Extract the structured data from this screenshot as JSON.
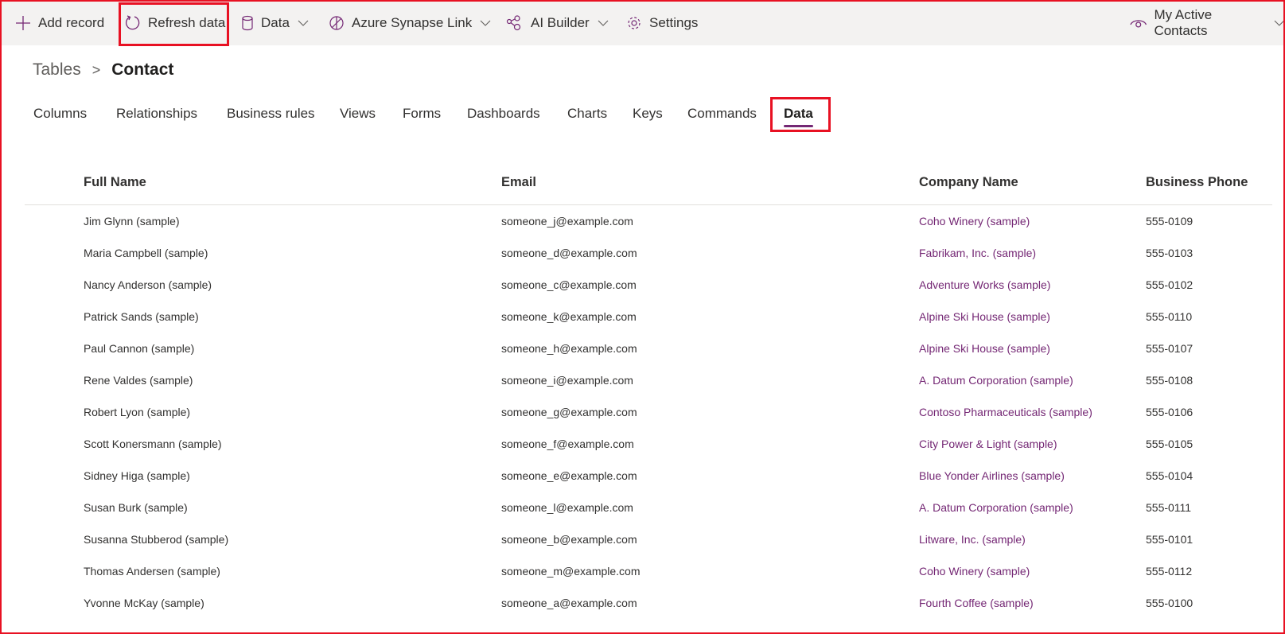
{
  "toolbar": {
    "add_record": "Add record",
    "refresh_data": "Refresh data",
    "data": "Data",
    "azure_synapse_link": "Azure Synapse Link",
    "ai_builder": "AI Builder",
    "settings": "Settings",
    "view_selector": "My Active Contacts"
  },
  "breadcrumb": {
    "parent": "Tables",
    "separator": ">",
    "current": "Contact"
  },
  "tabs": [
    {
      "label": "Columns"
    },
    {
      "label": "Relationships"
    },
    {
      "label": "Business rules"
    },
    {
      "label": "Views"
    },
    {
      "label": "Forms"
    },
    {
      "label": "Dashboards"
    },
    {
      "label": "Charts"
    },
    {
      "label": "Keys"
    },
    {
      "label": "Commands"
    },
    {
      "label": "Data",
      "active": true
    }
  ],
  "table": {
    "columns": [
      "Full Name",
      "Email",
      "Company Name",
      "Business Phone"
    ],
    "rows": [
      [
        "Jim Glynn (sample)",
        "someone_j@example.com",
        "Coho Winery (sample)",
        "555-0109"
      ],
      [
        "Maria Campbell (sample)",
        "someone_d@example.com",
        "Fabrikam, Inc. (sample)",
        "555-0103"
      ],
      [
        "Nancy Anderson (sample)",
        "someone_c@example.com",
        "Adventure Works (sample)",
        "555-0102"
      ],
      [
        "Patrick Sands (sample)",
        "someone_k@example.com",
        "Alpine Ski House (sample)",
        "555-0110"
      ],
      [
        "Paul Cannon (sample)",
        "someone_h@example.com",
        "Alpine Ski House (sample)",
        "555-0107"
      ],
      [
        "Rene Valdes (sample)",
        "someone_i@example.com",
        "A. Datum Corporation (sample)",
        "555-0108"
      ],
      [
        "Robert Lyon (sample)",
        "someone_g@example.com",
        "Contoso Pharmaceuticals (sample)",
        "555-0106"
      ],
      [
        "Scott Konersmann (sample)",
        "someone_f@example.com",
        "City Power & Light (sample)",
        "555-0105"
      ],
      [
        "Sidney Higa (sample)",
        "someone_e@example.com",
        "Blue Yonder Airlines (sample)",
        "555-0104"
      ],
      [
        "Susan Burk (sample)",
        "someone_l@example.com",
        "A. Datum Corporation (sample)",
        "555-0111"
      ],
      [
        "Susanna Stubberod (sample)",
        "someone_b@example.com",
        "Litware, Inc. (sample)",
        "555-0101"
      ],
      [
        "Thomas Andersen (sample)",
        "someone_m@example.com",
        "Coho Winery (sample)",
        "555-0112"
      ],
      [
        "Yvonne McKay (sample)",
        "someone_a@example.com",
        "Fourth Coffee (sample)",
        "555-0100"
      ]
    ]
  },
  "colors": {
    "accent": "#742774",
    "highlight": "#e81123",
    "toolbar_bg": "#f3f2f1"
  }
}
